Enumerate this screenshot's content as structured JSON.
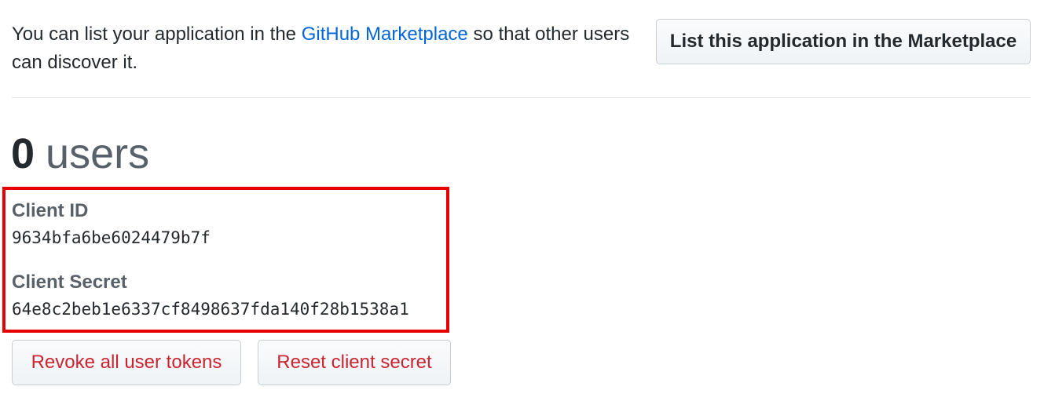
{
  "marketplace": {
    "intro_before": "You can list your application in the ",
    "link_text": "GitHub Marketplace",
    "intro_after": " so that other users can discover it.",
    "button_label": "List this application in the Marketplace"
  },
  "users": {
    "count": "0",
    "label": "users"
  },
  "credentials": {
    "client_id_label": "Client ID",
    "client_id_value": "9634bfa6be6024479b7f",
    "client_secret_label": "Client Secret",
    "client_secret_value": "64e8c2beb1e6337cf8498637fda140f28b1538a1"
  },
  "actions": {
    "revoke_label": "Revoke all user tokens",
    "reset_label": "Reset client secret"
  },
  "colors": {
    "link": "#0366d6",
    "danger": "#cb2431",
    "highlight_border": "#e60000"
  }
}
